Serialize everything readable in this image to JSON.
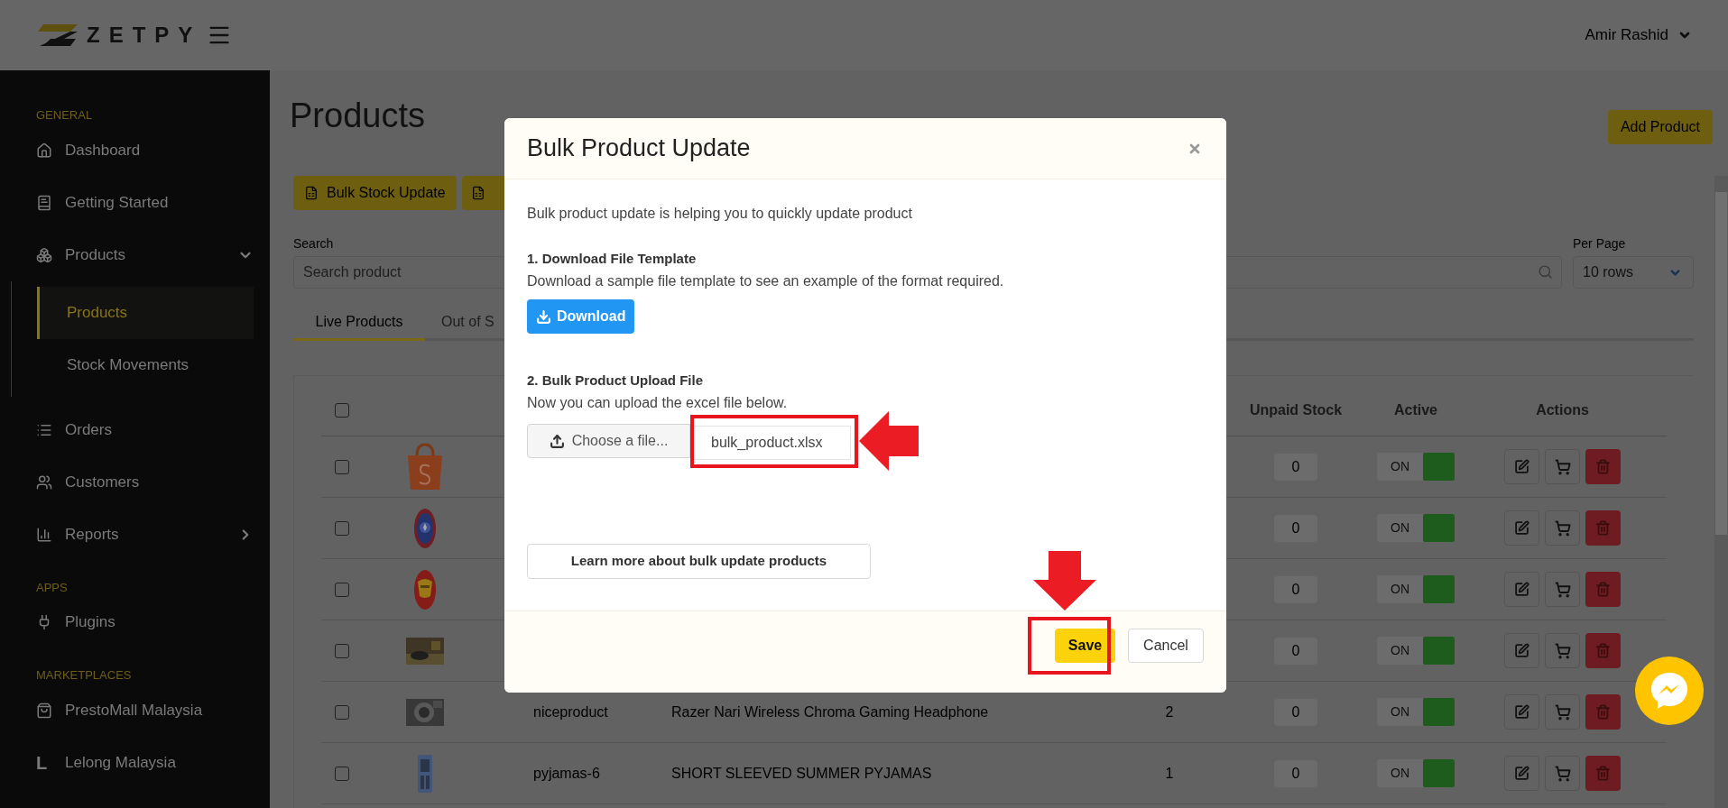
{
  "header": {
    "logo_text": "ZETPY",
    "user": "Amir Rashid"
  },
  "sidebar": {
    "sections": [
      {
        "heading": "GENERAL",
        "items": [
          {
            "label": "Dashboard",
            "kind": "link"
          },
          {
            "label": "Getting Started",
            "kind": "link"
          },
          {
            "label": "Products",
            "kind": "group",
            "expanded": true,
            "children": [
              {
                "label": "Products",
                "selected": true
              },
              {
                "label": "Stock Movements",
                "selected": false
              }
            ]
          },
          {
            "label": "Orders",
            "kind": "link"
          },
          {
            "label": "Customers",
            "kind": "link"
          },
          {
            "label": "Reports",
            "kind": "group",
            "expanded": false
          }
        ]
      },
      {
        "heading": "APPS",
        "items": [
          {
            "label": "Plugins",
            "kind": "link"
          }
        ]
      },
      {
        "heading": "MARKETPLACES",
        "items": [
          {
            "label": "PrestoMall Malaysia",
            "kind": "link"
          },
          {
            "label": "Lelong Malaysia",
            "kind": "link",
            "icon_text": "L"
          }
        ]
      }
    ]
  },
  "page": {
    "title": "Products",
    "add_button": "Add Product",
    "toolbar_buttons": [
      "Bulk Stock Update"
    ],
    "search": {
      "label": "Search",
      "placeholder": "Search product"
    },
    "per_page": {
      "label": "Per Page",
      "value": "10 rows"
    },
    "tabs": [
      {
        "label": "Live Products",
        "selected": true
      },
      {
        "label": "Out of S",
        "selected": false
      }
    ],
    "table": {
      "header_checked": false,
      "columns": [
        "Unpaid Stock",
        "Active",
        "Actions"
      ],
      "rows": [
        {
          "checked": false,
          "unpaid": "0",
          "active": {
            "label": "ON",
            "on": true
          }
        },
        {
          "checked": false,
          "unpaid": "0",
          "active": {
            "label": "ON",
            "on": true
          }
        },
        {
          "checked": false,
          "unpaid": "0",
          "active": {
            "label": "ON",
            "on": true
          }
        },
        {
          "checked": false,
          "unpaid": "0",
          "active": {
            "label": "ON",
            "on": true
          }
        },
        {
          "checked": false,
          "sku": "niceproduct",
          "name": "Razer Nari Wireless Chroma Gaming Headphone",
          "quantity": "2",
          "unpaid": "0",
          "active": {
            "label": "ON",
            "on": true
          }
        },
        {
          "checked": false,
          "sku": "pyjamas-6",
          "name": "SHORT SLEEVED SUMMER PYJAMAS",
          "quantity": "1",
          "unpaid": "0",
          "active": {
            "label": "ON",
            "on": true
          }
        }
      ]
    }
  },
  "modal": {
    "title": "Bulk Product Update",
    "intro": "Bulk product update is helping you to quickly update product",
    "steps": [
      {
        "heading": "1. Download File Template",
        "text": "Download a sample file template to see an example of the format required."
      },
      {
        "heading": "2. Bulk Product Upload File",
        "text": "Now you can upload the excel file below."
      }
    ],
    "download_button": "Download",
    "choose_button": "Choose a file...",
    "file_name": "bulk_product.xlsx",
    "learn_more": "Learn more about bulk update products",
    "save_button": "Save",
    "cancel_button": "Cancel"
  }
}
